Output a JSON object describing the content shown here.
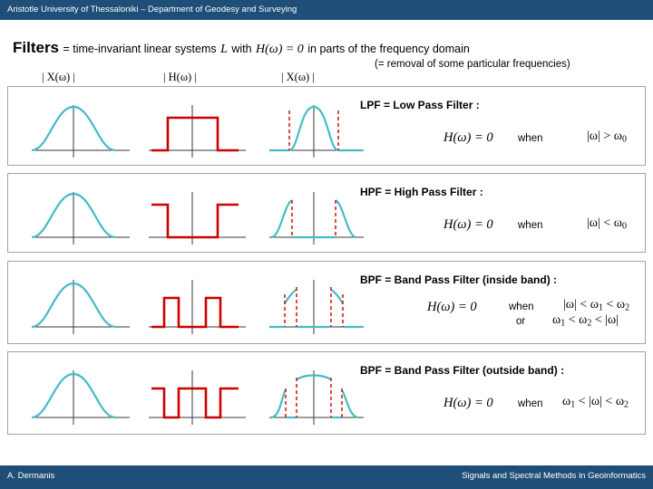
{
  "header": {
    "institution": "Aristotle University of Thessaloniki – Department of Geodesy and Surveying"
  },
  "footer": {
    "author": "A. Dermanis",
    "course": "Signals and Spectral Methods in Geoinformatics"
  },
  "title": {
    "word": "Filters",
    "rest_a": "= time-invariant linear systems",
    "symbol_L": "L",
    "rest_b": "with",
    "equation": "H(ω) = 0",
    "rest_c": "in parts of the frequency domain",
    "note": "(= removal of some particular frequencies)"
  },
  "column_labels": {
    "input": "| X(ω) |",
    "transfer": "| H(ω) |",
    "output": "| X(ω) |"
  },
  "rows": [
    {
      "title": "LPF = Low Pass Filter :",
      "equation": "H(ω) = 0",
      "when": "when",
      "condition": "|ω| > ω",
      "condition_sub": "0"
    },
    {
      "title": "HPF = High Pass Filter :",
      "equation": "H(ω) = 0",
      "when": "when",
      "condition": "|ω| < ω",
      "condition_sub": "0"
    },
    {
      "title": "BPF = Band Pass Filter (inside band) :",
      "equation": "H(ω) = 0",
      "when": "when",
      "or": "or",
      "condition_1": "|ω| < ω",
      "condition_1_sub1": "1",
      "condition_1_mid": " < ω",
      "condition_1_sub2": "2",
      "condition_2": "ω",
      "condition_2_sub1": "1",
      "condition_2_mid": " < ω",
      "condition_2_sub2": "2",
      "condition_2_end": " < |ω|"
    },
    {
      "title": "BPF = Band Pass Filter (outside band) :",
      "equation": "H(ω) = 0",
      "when": "when",
      "condition_a": "ω",
      "condition_sub_a": "1",
      "condition_mid": " < |ω| < ω",
      "condition_sub_b": "2"
    }
  ],
  "colors": {
    "bar": "#1f4e79",
    "signal": "#45bcc8",
    "transfer": "#cc0000",
    "axis": "#3a3a3a",
    "panel_border": "#9aa5ad"
  }
}
